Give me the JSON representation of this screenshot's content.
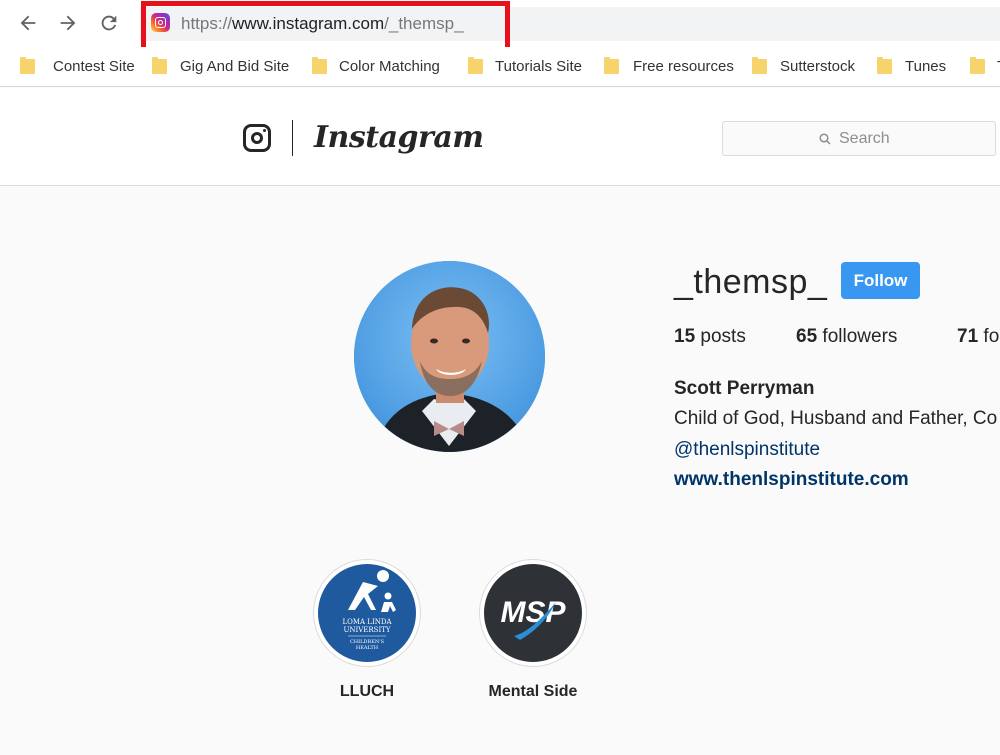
{
  "browser": {
    "url_prefix": "https://",
    "url_host": "www.instagram.com",
    "url_path": "/_themsp_",
    "bookmarks": [
      {
        "label": "Contest Site"
      },
      {
        "label": "Gig And Bid Site"
      },
      {
        "label": "Color Matching"
      },
      {
        "label": "Tutorials Site"
      },
      {
        "label": "Free resources"
      },
      {
        "label": "Sutterstock"
      },
      {
        "label": "Tunes"
      },
      {
        "label": "T"
      }
    ]
  },
  "instagram": {
    "wordmark": "Instagram",
    "search_placeholder": "Search"
  },
  "profile": {
    "username": "_themsp_",
    "follow_label": "Follow",
    "posts_count": "15",
    "posts_label": "posts",
    "followers_count": "65",
    "followers_label": "followers",
    "following_count": "71",
    "following_label": "fo",
    "full_name": "Scott Perryman",
    "bio": "Child of God, Husband and Father, Co",
    "mention": "@thenlspinstitute",
    "website": "www.thenlspinstitute.com"
  },
  "highlights": [
    {
      "label": "LLUCH",
      "logo_line1": "LOMA LINDA",
      "logo_line2": "UNIVERSITY",
      "logo_line3": "CHILDREN'S",
      "logo_line4": "HEALTH"
    },
    {
      "label": "Mental Side",
      "logo_text": "MSP"
    }
  ],
  "colors": {
    "accent": "#3897f0",
    "link": "#003569",
    "highlight_box": "#e8111b",
    "folder": "#f7d36b"
  }
}
